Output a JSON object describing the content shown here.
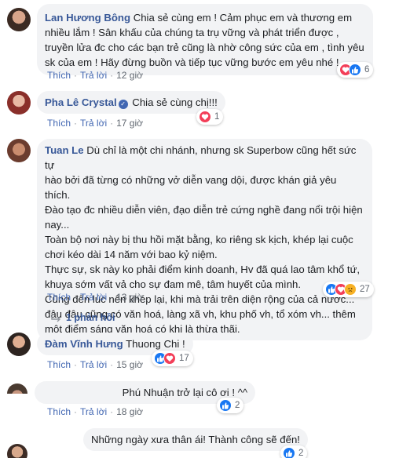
{
  "actions": {
    "like": "Thích",
    "reply": "Trả lời",
    "dot": "·"
  },
  "comments": [
    {
      "author": "Lan Hương Bông",
      "text": "Chia sẻ cùng em ! Cảm phục em và thương em nhiều lắm ! Sân khấu của chúng ta trụ vững và phát triển được , truyền lửa đc cho các bạn trẻ cũng là nhờ công sức của em , tình yêu sk của em ! Hãy đừng buồn và tiếp tục vững bước em yêu nhé !",
      "time": "12 giờ",
      "reactions": [
        "love",
        "like"
      ],
      "count": "6"
    },
    {
      "author": "Pha Lê Crystal",
      "verified": true,
      "text": "Chia sẻ cùng chị!!!",
      "time": "17 giờ",
      "reactions": [
        "love"
      ],
      "count": "1"
    },
    {
      "author": "Tuan Le",
      "lines": [
        "Dù chỉ là một chi nhánh, nhưng sk Superbow cũng hết sức tự",
        "hào bởi đã từng có những vở diễn vang dội, được khán giả yêu thích.",
        "Đào tạo đc nhiều diễn viên, đạo diễn trẻ cứng nghề đang nổi trội hiện",
        "nay...",
        "Toàn bộ nơi này bị thu hồi mặt bằng, ko riêng sk kịch, khép lại cuộc",
        "chơi kéo dài 14 năm với bao kỷ niệm.",
        "Thực sự, sk này ko phải điểm kinh doanh, Hv đã quá lao tâm khổ tứ,",
        "khuya sớm vất vả cho sự đam mê, tâm huyết của mình.",
        "Cũng đến lúc nên khép lại, khi mà trải trên diện rộng của cả nước...",
        "đâu đâu cũng có văn hoá, làng xã vh, khu phố vh, tổ xóm vh... thêm",
        "một điểm sáng văn hoá có khi là thừa thãi."
      ],
      "time": "13 giờ",
      "reactions": [
        "like",
        "love",
        "sad"
      ],
      "count": "27",
      "replies": "1 phản hồi"
    },
    {
      "author": "Đàm Vĩnh Hưng",
      "text": "Thuong Chi !",
      "time": "15 giờ",
      "reactions": [
        "like",
        "love"
      ],
      "count": "17"
    },
    {
      "author": "",
      "text": "Phú Nhuận trở lại cô ơi ! ^^",
      "time": "18 giờ",
      "reactions": [
        "like"
      ],
      "count": "2"
    },
    {
      "author": "",
      "text": "Những ngày xưa thân ái! Thành công sẽ đến!",
      "reactions": [
        "like"
      ],
      "count": "2"
    }
  ],
  "colors": {
    "author": "#385898",
    "link": "#4267b2",
    "bubble": "#f2f3f5",
    "like": "#1877f2",
    "love": "#f33e58",
    "sad": "#f7b125"
  },
  "icons": {
    "like": "thumbs-up-icon",
    "love": "heart-icon",
    "sad": "sad-face-icon",
    "reply_arrow": "reply-arrow-icon",
    "verified": "verified-badge-icon"
  }
}
